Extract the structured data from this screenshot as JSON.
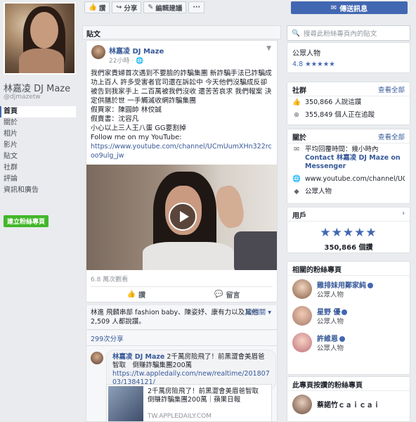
{
  "page": {
    "name": "林嘉凌 DJ Maze",
    "handle": "@djmazetw"
  },
  "nav": {
    "items": [
      "首頁",
      "關於",
      "相片",
      "影片",
      "貼文",
      "社群",
      "評論",
      "資訊和廣告"
    ],
    "active_index": 0,
    "create_page": "建立粉絲專頁"
  },
  "actionbar": {
    "like": "讚",
    "share": "分享",
    "suggest": "編輯建議",
    "more": "···",
    "message": "傳送訊息"
  },
  "posts_section": {
    "title": "貼文"
  },
  "post": {
    "author": "林嘉凌 DJ Maze",
    "time": "22小時",
    "body": "我們家貴婦首次遇到不要臉的詐騙集團 新詐騙手法已詐騙成功上百人 許多受害者官司還在訴訟中 今天他們沒騙成反卻被告到我家手上 二百萬被我們沒收 還苦苦哀求 我們報案 決定供膳於世 一手觸滅收網詐騙集團\n假買家：陳圓帥 林佼誠\n假賣書：沈容凡\n小心以上三人王八蛋 GG要割掉\nFollow me on my YouTube:",
    "link": "https://www.youtube.com/channel/UCmUumXHn322rcoo9ulg_jw",
    "views": "6.8 萬次觀看",
    "like_label": "讚",
    "comment_label": "留言",
    "likes_text_prefix": "林進 飛麟串部 fashion baby、陳姿妤、康有力以及其他 2,509 人都說讚。",
    "relevance": "最相關",
    "shares": "299次分享"
  },
  "comment": {
    "author": "林嘉凌 DJ Maze",
    "text": "2千萬房險飛了！前黑澀會美眉爸智取　倒賺詐騙集團200萬",
    "link": "https://tw.appledaily.com/new/realtime/20180703/1384121/",
    "preview_title": "2千萬房險飛了！前黑澀會美眉爸智取　倒賺詐騙集團200萬｜蘋果日報",
    "preview_domain": "TW.APPLEDAILY.COM"
  },
  "right": {
    "search_placeholder": "搜尋此粉絲專頁內的貼文",
    "category": "公眾人物",
    "rating": "4.8",
    "community_title": "社群",
    "see_all": "查看全部",
    "likes_count": "350,866 人說這讚",
    "followers_count": "355,849 個人正在追蹤",
    "about_title": "關於",
    "response_time": "平均回覆時間：幾小時內",
    "contact": "Contact 林嘉凌 DJ Maze on Messenger",
    "youtube": "www.youtube.com/channel/UCm",
    "about_category": "公眾人物",
    "users_title": "用戶",
    "users_count": "350,866 個讚",
    "related_title": "相關的粉絲專頁",
    "related": [
      {
        "name": "雞排妹用鄭家純",
        "category": "公眾人物",
        "verified": true
      },
      {
        "name": "星野 優",
        "category": "公眾人物",
        "verified": true
      },
      {
        "name": "許維恩",
        "category": "公眾人物",
        "verified": true
      }
    ],
    "liked_title": "此專頁按讚的粉絲專頁",
    "liked_item": "蔡諾竹ｃａｉｃａｉ"
  },
  "colors": {
    "brand": "#4267b2",
    "link": "#365899",
    "green": "#42b72a",
    "background": "#e9ebee"
  }
}
